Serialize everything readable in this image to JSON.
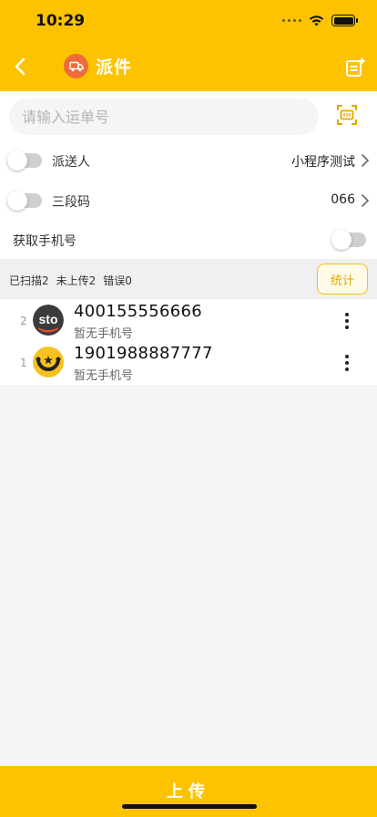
{
  "status_bar": {
    "time": "10:29"
  },
  "nav": {
    "title": "派件"
  },
  "search": {
    "placeholder": "请输入运单号",
    "value": ""
  },
  "settings": [
    {
      "label": "派送人",
      "value": "小程序测试",
      "has_chevron": true
    },
    {
      "label": "三段码",
      "value": "066",
      "has_chevron": true
    },
    {
      "label": "获取手机号",
      "value": "",
      "has_chevron": false
    }
  ],
  "stats": {
    "scanned": "已扫描2",
    "not_uploaded": "未上传2",
    "errors": "错误0",
    "button": "统计"
  },
  "items": [
    {
      "index": "2",
      "number": "400155556666",
      "phone": "暂无手机号",
      "logo": "sto-express-logo"
    },
    {
      "index": "1",
      "number": "1901988887777",
      "phone": "暂无手机号",
      "logo": "star-smile-logo"
    }
  ],
  "upload_label": "上传",
  "colors": {
    "primary": "#fec300",
    "accent_badge": "#f06b3b",
    "stats_button": "#f5bf0c"
  }
}
